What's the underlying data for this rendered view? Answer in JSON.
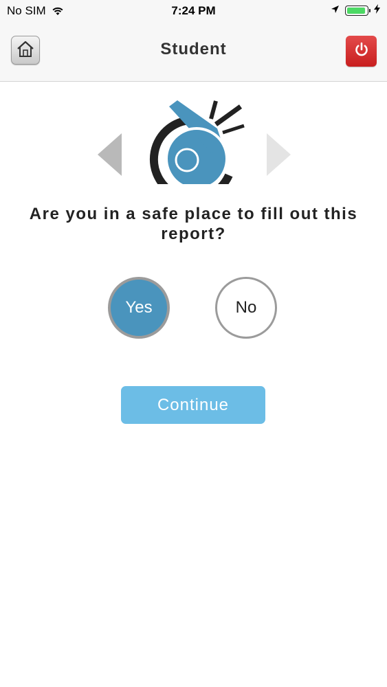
{
  "status_bar": {
    "carrier": "No SIM",
    "time": "7:24 PM",
    "battery_level": 0.95,
    "icons": [
      "wifi-icon",
      "location-arrow-icon",
      "battery-icon",
      "charging-bolt-icon"
    ]
  },
  "nav": {
    "title": "Student",
    "home_icon": "home-icon",
    "power_icon": "power-icon"
  },
  "colors": {
    "accent": "#4a94bd",
    "continue": "#6cbde6",
    "power": "#d63333",
    "logo_dark": "#222222"
  },
  "question": {
    "text": "Are you in a safe place to fill out this report?"
  },
  "choices": {
    "yes": "Yes",
    "no": "No",
    "selected": "Yes"
  },
  "continue_label": "Continue"
}
